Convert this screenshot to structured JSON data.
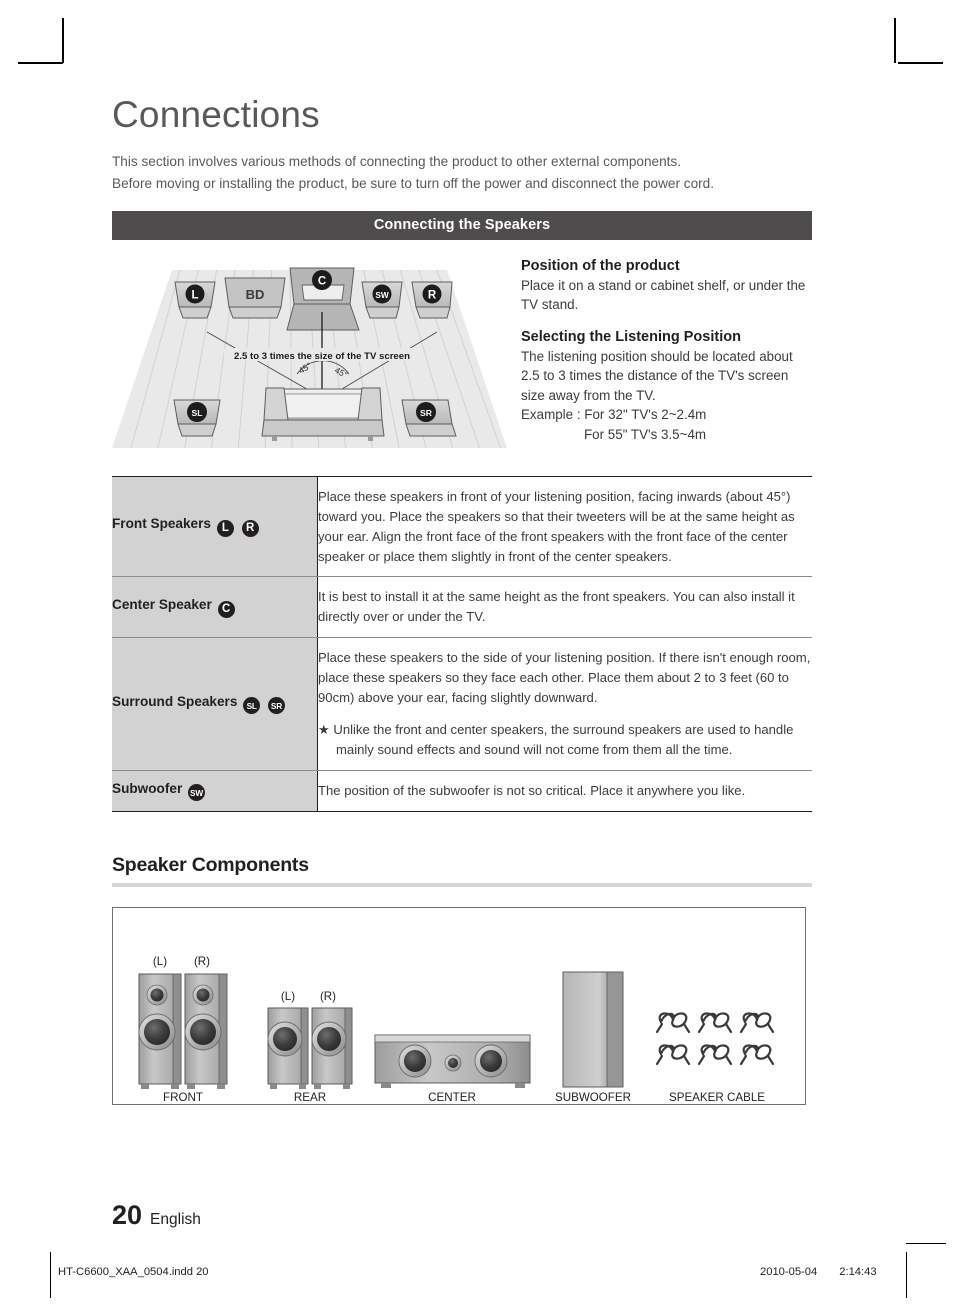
{
  "header": {
    "title": "Connections",
    "intro_line1": "This section involves various methods of connecting the product to other external components.",
    "intro_line2": "Before moving or installing the product, be sure to turn off the power and disconnect the power cord.",
    "section_bar": "Connecting the Speakers"
  },
  "diagram": {
    "labels": {
      "left": "L",
      "bd": "BD",
      "center": "C",
      "subwoofer": "SW",
      "right": "R",
      "surround_left": "SL",
      "surround_right": "SR"
    },
    "distance_caption": "2.5 to 3 times the size of the TV screen",
    "angle_left": "45°",
    "angle_right": "45°"
  },
  "sidenotes": {
    "position_heading": "Position of the product",
    "position_body": "Place it on a stand or cabinet shelf, or under the TV stand.",
    "listening_heading": "Selecting the Listening Position",
    "listening_body": "The listening position should be located about 2.5 to 3 times the distance of the TV's screen size away from the TV.",
    "example_line1": "Example : For 32\" TV's 2~2.4m",
    "example_line2": "For 55\" TV's 3.5~4m"
  },
  "spec_table": {
    "rows": [
      {
        "label": "Front Speakers",
        "badges": [
          "L",
          "R"
        ],
        "desc": "Place these speakers in front of your listening position, facing inwards (about 45°) toward you. Place the speakers so that their tweeters will be at the same height as your ear. Align the front face of the front speakers with the front face of the center speaker or place them slightly in front of the center speakers.",
        "note": "",
        "note_sub": ""
      },
      {
        "label": "Center Speaker",
        "badges": [
          "C"
        ],
        "desc": "It is best to install it at the same height as the front speakers. You can also install it directly over or under the TV.",
        "note": "",
        "note_sub": ""
      },
      {
        "label": "Surround Speakers",
        "badges": [
          "SL",
          "SR"
        ],
        "desc": "Place these speakers to the side of your listening position. If there isn't enough room, place these speakers so they face each other. Place them about 2 to 3 feet (60 to 90cm) above your ear, facing slightly downward.",
        "note": "★ Unlike the front and center speakers, the surround speakers are used to handle",
        "note_sub": "mainly sound effects and sound will not come from them all the time."
      },
      {
        "label": "Subwoofer",
        "badges": [
          "SW"
        ],
        "desc": "The position of the subwoofer is not so critical. Place it anywhere you like.",
        "note": "",
        "note_sub": ""
      }
    ]
  },
  "components": {
    "heading": "Speaker Components",
    "items": [
      {
        "caption": "FRONT",
        "channel_left": "(L)",
        "channel_right": "(R)"
      },
      {
        "caption": "REAR",
        "channel_left": "(L)",
        "channel_right": "(R)"
      },
      {
        "caption": "CENTER",
        "channel_left": "",
        "channel_right": ""
      },
      {
        "caption": "SUBWOOFER",
        "channel_left": "",
        "channel_right": ""
      },
      {
        "caption": "SPEAKER CABLE",
        "channel_left": "",
        "channel_right": ""
      }
    ]
  },
  "footer": {
    "page_number": "20",
    "language": "English",
    "file_name": "HT-C6600_XAA_0504.indd   20",
    "date": "2010-05-04",
    "time": "2:14:43"
  },
  "colors": {
    "section_bar": "#4e4c4c",
    "table_label_bg": "#d2d2d2",
    "title_gray": "#58595b",
    "rule_gray": "#d6d6d6"
  }
}
